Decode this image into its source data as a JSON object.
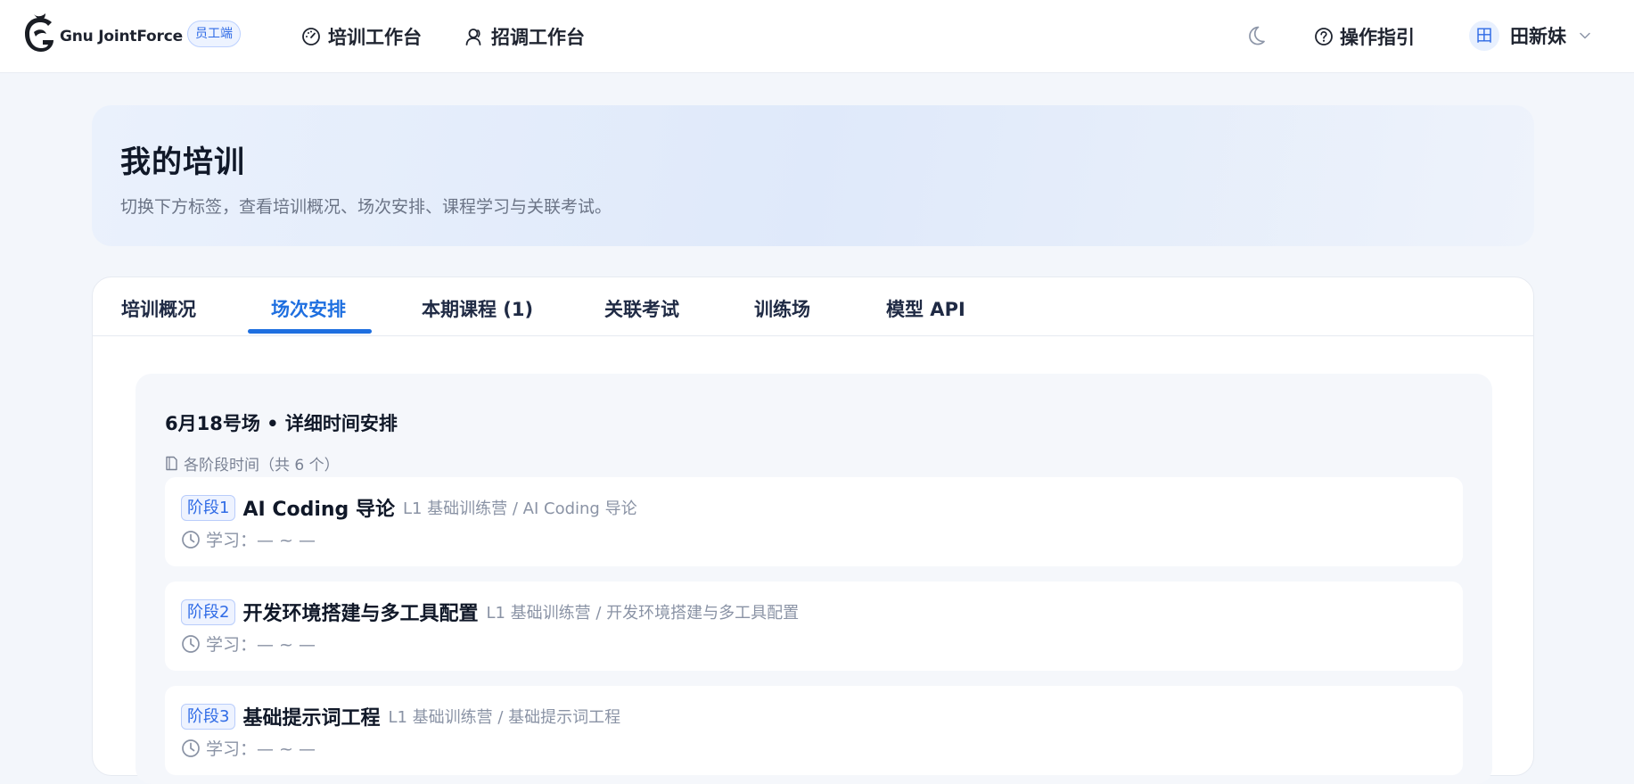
{
  "header": {
    "brand": "Gnu JointForce",
    "role_badge": "员工端",
    "nav": [
      {
        "label": "培训工作台",
        "icon": "dashboard-icon"
      },
      {
        "label": "招调工作台",
        "icon": "user-icon"
      }
    ],
    "guide_label": "操作指引",
    "user": {
      "avatar_text": "田",
      "name": "田新妹"
    }
  },
  "hero": {
    "title": "我的培训",
    "subtitle": "切换下方标签，查看培训概况、场次安排、课程学习与关联考试。"
  },
  "tabs": [
    {
      "label": "培训概况",
      "active": false
    },
    {
      "label": "场次安排",
      "active": true
    },
    {
      "label": "本期课程 (1)",
      "active": false
    },
    {
      "label": "关联考试",
      "active": false
    },
    {
      "label": "训练场",
      "active": false
    },
    {
      "label": "模型 API",
      "active": false
    }
  ],
  "schedule": {
    "title": "6月18号场 • 详细时间安排",
    "meta": "各阶段时间（共 6 个）",
    "stages": [
      {
        "badge": "阶段1",
        "name": "AI Coding 导论",
        "path": "L1 基础训练营 / AI Coding 导论",
        "time": "学习：— ~ —"
      },
      {
        "badge": "阶段2",
        "name": "开发环境搭建与多工具配置",
        "path": "L1 基础训练营 / 开发环境搭建与多工具配置",
        "time": "学习：— ~ —"
      },
      {
        "badge": "阶段3",
        "name": "基础提示词工程",
        "path": "L1 基础训练营 / 基础提示词工程",
        "time": "学习：— ~ —"
      }
    ]
  },
  "colors": {
    "accent": "#1e6fe0",
    "badge_bg": "#eef3ff",
    "page_bg": "#f3f6fb"
  }
}
